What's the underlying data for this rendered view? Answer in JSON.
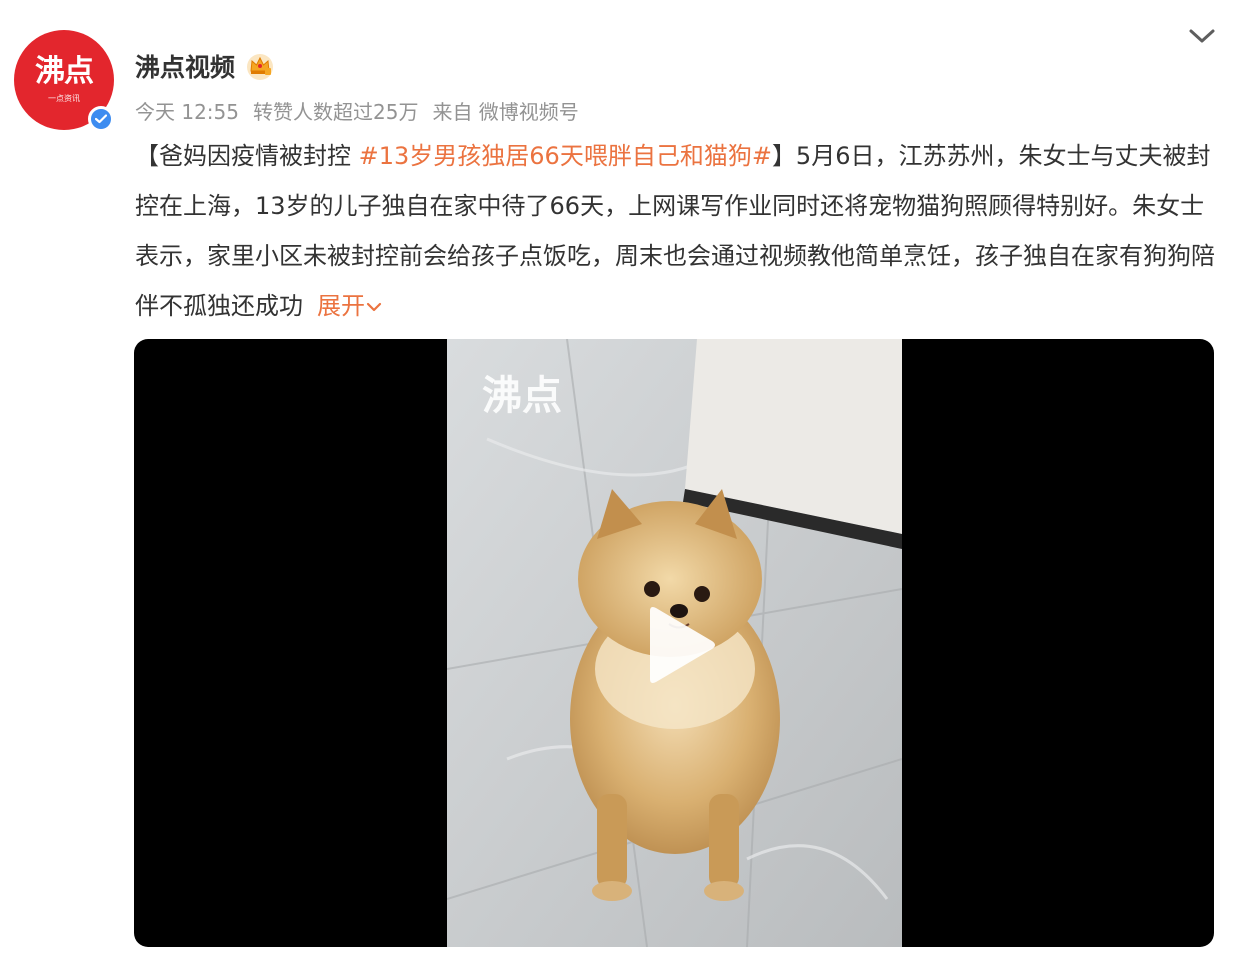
{
  "account": {
    "name": "沸点视频",
    "avatar_logo": "沸点",
    "avatar_tagline": "一点资讯",
    "crown_icon": "member-crown-icon",
    "verified_icon": "verified-check-icon"
  },
  "meta": {
    "time": "今天 12:55",
    "reposts": "转赞人数超过25万",
    "source": "来自 微博视频号"
  },
  "menu_icon": "chevron-down-icon",
  "post": {
    "prefix": "【爸妈因疫情被封控 ",
    "topic": "#13岁男孩独居66天喂胖自己和猫狗#",
    "body": "】5月6日，江苏苏州，朱女士与丈夫被封控在上海，13岁的儿子独自在家中待了66天，上网课写作业同时还将宠物猫狗照顾得特别好。朱女士表示，家里小区未被封控前会给孩子点饭吃，周末也会通过视频教他简单烹饪，孩子独自在家有狗狗陪伴不孤独还成功",
    "expand_label": "展开"
  },
  "video": {
    "watermark": "沸点",
    "play_icon": "play-icon"
  },
  "colors": {
    "accent": "#eb7340",
    "brand_red": "#e3262d",
    "verified_blue": "#3d8cf0",
    "meta_gray": "#939393",
    "text": "#333333"
  }
}
